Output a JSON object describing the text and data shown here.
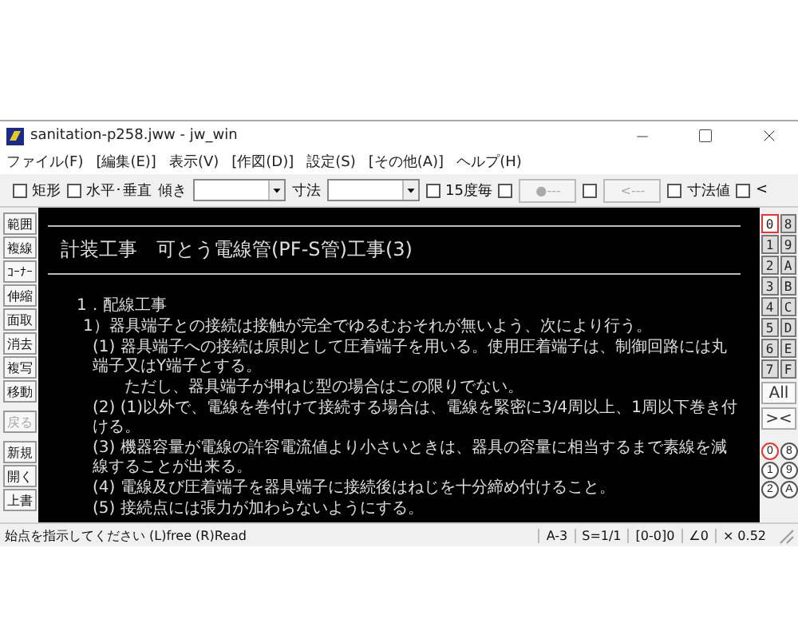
{
  "window": {
    "title": "sanitation-p258.jww - jw_win"
  },
  "menu": [
    "ファイル(F)",
    "[編集(E)]",
    "表示(V)",
    "[作図(D)]",
    "設定(S)",
    "[その他(A)]",
    "ヘルプ(H)"
  ],
  "toolbar": [
    {
      "kind": "checkbox",
      "label": "矩形",
      "checked": false
    },
    {
      "kind": "checkbox",
      "label": "水平･垂直",
      "checked": false
    },
    {
      "kind": "label",
      "label": "傾き"
    },
    {
      "kind": "combo"
    },
    {
      "kind": "label",
      "label": "寸法"
    },
    {
      "kind": "combo"
    },
    {
      "kind": "checkbox",
      "label": "15度毎",
      "checked": false
    },
    {
      "kind": "checkbox",
      "checked": false
    },
    {
      "kind": "button",
      "label": "●---",
      "disabled": true
    },
    {
      "kind": "checkbox",
      "checked": false
    },
    {
      "kind": "button",
      "label": "<---",
      "disabled": true
    },
    {
      "kind": "checkbox",
      "label": "寸法値",
      "checked": false
    },
    {
      "kind": "checkbox",
      "label": "<",
      "checked": false
    }
  ],
  "left_tools": [
    {
      "label": "範囲",
      "disabled": false
    },
    {
      "label": "複線",
      "disabled": false
    },
    {
      "label": "ｺｰﾅｰ",
      "disabled": false
    },
    {
      "label": "伸縮",
      "disabled": false
    },
    {
      "label": "面取",
      "disabled": false
    },
    {
      "label": "消去",
      "disabled": false
    },
    {
      "label": "複写",
      "disabled": false
    },
    {
      "label": "移動",
      "disabled": false
    },
    {
      "label": "戻る",
      "disabled": true
    },
    {
      "label": "新規",
      "disabled": false
    },
    {
      "label": "開く",
      "disabled": false
    },
    {
      "label": "上書",
      "disabled": false
    }
  ],
  "drawing": {
    "title": "計装工事　可とう電線管(PF-S管)工事(3)",
    "lines": [
      {
        "kind": "heading",
        "text": "1．配線工事"
      },
      {
        "kind": "section",
        "text": "1）器具端子との接続は接触が完全でゆるむおそれが無いよう、次により行う。"
      },
      {
        "kind": "item",
        "text": "(1) 器具端子への接続は原則として圧着端子を用いる。使用圧着端子は、制御回路には丸端子又はY端子とする。"
      },
      {
        "kind": "note",
        "text": "ただし、器具端子が押ねじ型の場合はこの限りでない。"
      },
      {
        "kind": "item",
        "text": "(2) (1)以外で、電線を巻付けて接続する場合は、電線を緊密に3/4周以上、1周以下巻き付ける。"
      },
      {
        "kind": "item",
        "text": "(3) 機器容量が電線の許容電流値より小さいときは、器具の容量に相当するまで素線を減線することが出来る。"
      },
      {
        "kind": "item",
        "text": "(4) 電線及び圧着端子を器具端子に接続後はねじを十分締め付けること。"
      },
      {
        "kind": "item",
        "text": "(5) 接続点には張力が加わらないようにする。"
      }
    ]
  },
  "layers": [
    {
      "label": "0",
      "selected": true
    },
    {
      "label": "8",
      "selected": false
    },
    {
      "label": "1",
      "selected": false
    },
    {
      "label": "9",
      "selected": false
    },
    {
      "label": "2",
      "selected": false
    },
    {
      "label": "A",
      "selected": false
    },
    {
      "label": "3",
      "selected": false
    },
    {
      "label": "B",
      "selected": false
    },
    {
      "label": "4",
      "selected": false
    },
    {
      "label": "C",
      "selected": false
    },
    {
      "label": "5",
      "selected": false
    },
    {
      "label": "D",
      "selected": false
    },
    {
      "label": "6",
      "selected": false
    },
    {
      "label": "E",
      "selected": false
    },
    {
      "label": "7",
      "selected": false
    },
    {
      "label": "F",
      "selected": false
    }
  ],
  "layer_actions": [
    "All",
    "><"
  ],
  "layer_groups": [
    {
      "label": "0",
      "selected": true
    },
    {
      "label": "8",
      "selected": false
    },
    {
      "label": "1",
      "selected": false
    },
    {
      "label": "9",
      "selected": false
    },
    {
      "label": "2",
      "selected": false
    },
    {
      "label": "A",
      "selected": false
    }
  ],
  "status": {
    "message": "始点を指示してください (L)free (R)Read",
    "cells": [
      "A-3",
      "S=1/1",
      "[0-0]0",
      "∠0",
      "× 0.52"
    ]
  }
}
